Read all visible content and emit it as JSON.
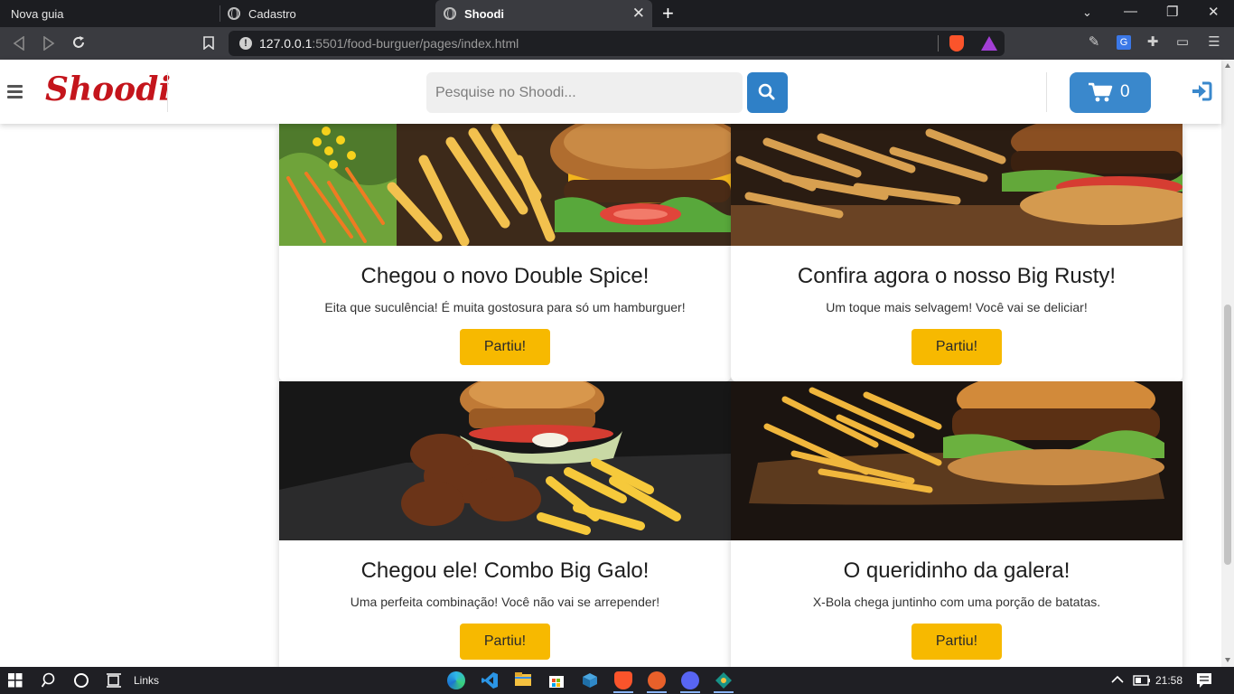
{
  "browser": {
    "tabs": [
      {
        "title": "Nova guia"
      },
      {
        "title": "Cadastro"
      },
      {
        "title": "Shoodi"
      }
    ],
    "url_host": "127.0.0.1",
    "url_rest": ":5501/food-burguer/pages/index.html"
  },
  "header": {
    "logo": "Shoodi",
    "search_placeholder": "Pesquise no Shoodi...",
    "cart_count": "0"
  },
  "cards": [
    {
      "title": "Chegou o novo Double Spice!",
      "text": "Eita que suculência! É muita gostosura para só um hamburguer!",
      "button": "Partiu!"
    },
    {
      "title": "Confira agora o nosso Big Rusty!",
      "text": "Um toque mais selvagem! Você vai se deliciar!",
      "button": "Partiu!"
    },
    {
      "title": "Chegou ele! Combo Big Galo!",
      "text": "Uma perfeita combinação! Você não vai se arrepender!",
      "button": "Partiu!"
    },
    {
      "title": "O queridinho da galera!",
      "text": "X-Bola chega juntinho com uma porção de batatas.",
      "button": "Partiu!"
    }
  ],
  "taskbar": {
    "links_label": "Links",
    "time": "21:58"
  },
  "colors": {
    "brand_red": "#c4151c",
    "primary_blue": "#3a88cc",
    "button_yellow": "#f7b900"
  }
}
